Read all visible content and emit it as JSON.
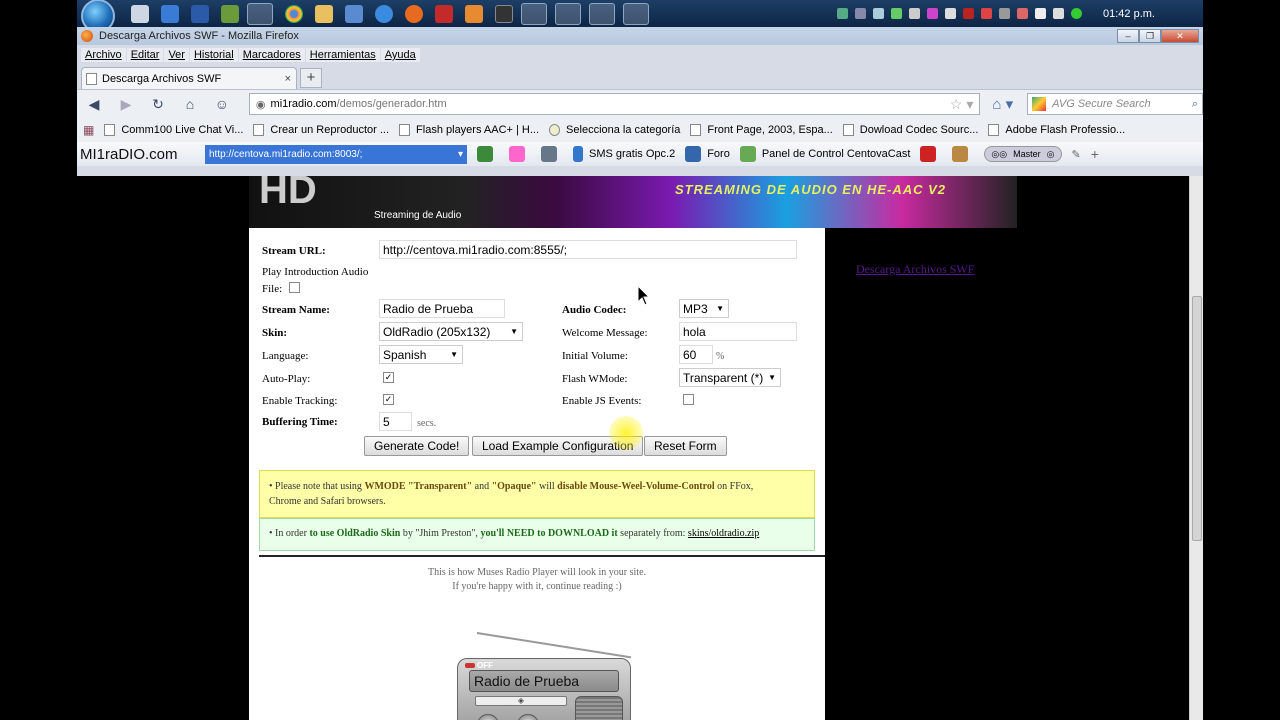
{
  "taskbar": {
    "clock": "01:42 p.m."
  },
  "browser": {
    "window_title": "Descarga Archivos SWF - Mozilla Firefox",
    "menu": [
      "Archivo",
      "Editar",
      "Ver",
      "Historial",
      "Marcadores",
      "Herramientas",
      "Ayuda"
    ],
    "tab_title": "Descarga Archivos SWF",
    "tab_close": "×",
    "new_tab": "+",
    "url_domain": "mi1radio.com",
    "url_path": "/demos/generador.htm",
    "search_placeholder": "AVG Secure Search",
    "bookmarks": [
      "Comm100 Live Chat Vi...",
      "Crear un Reproductor ...",
      "Flash players AAC+ | H...",
      "Selecciona la categoría",
      "Front Page, 2003, Espa...",
      "Dowload Codec Sourc...",
      "Adobe Flash Professio..."
    ],
    "toolbar": {
      "logo": "MI1raDIO.com",
      "url": "http://centova.mi1radio.com:8003/;",
      "sms": "SMS gratis Opc.2",
      "foro": "Foro",
      "panel": "Panel de Control CentovaCast",
      "master": "Master"
    }
  },
  "banner": {
    "hd": "HD",
    "subtitle": "Streaming de Audio",
    "title": "STREAMING DE AUDIO EN HE-AAC V2"
  },
  "form": {
    "stream_url_label": "Stream URL:",
    "stream_url_value": "http://centova.mi1radio.com:8555/;",
    "intro_label_1": "Play Introduction Audio",
    "intro_label_2": "File:",
    "stream_name_label": "Stream Name:",
    "stream_name_value": "Radio de Prueba",
    "audio_codec_label": "Audio Codec:",
    "audio_codec_value": "MP3",
    "skin_label": "Skin:",
    "skin_value": "OldRadio (205x132)",
    "welcome_label": "Welcome Message:",
    "welcome_value": "hola",
    "language_label": "Language:",
    "language_value": "Spanish",
    "volume_label": "Initial Volume:",
    "volume_value": "60",
    "volume_suffix": "%",
    "autoplay_label": "Auto-Play:",
    "wmode_label": "Flash WMode:",
    "wmode_value": "Transparent (*)",
    "tracking_label": "Enable Tracking:",
    "js_events_label": "Enable JS Events:",
    "buffering_label": "Buffering Time:",
    "buffering_value": "5",
    "buffering_suffix": "secs.",
    "generate_button": "Generate Code!",
    "load_example_button": "Load Example Configuration",
    "reset_button": "Reset Form"
  },
  "notes": {
    "yellow_1": "• Please note that using ",
    "yellow_2": "WMODE \"Transparent\"",
    "yellow_3": " and ",
    "yellow_4": "\"Opaque\"",
    "yellow_5": " will ",
    "yellow_6": "disable Mouse-Weel-Volume-Control",
    "yellow_7": " on FFox,",
    "yellow_8": "Chrome and Safari browsers.",
    "green_1": "• In order ",
    "green_2": "to use OldRadio Skin",
    "green_3": " by \"Jhim Preston\", ",
    "green_4": "you'll NEED to DOWNLOAD it",
    "green_5": " separately from: ",
    "green_link": "skins/oldradio.zip"
  },
  "preview": {
    "line1": "This is how Muses Radio Player will look in your site.",
    "line2": "If you're happy with it, continue reading :)",
    "radio_off": "OFF",
    "radio_name": "Radio de Prueba"
  },
  "sidebar": {
    "link": "Descarga Archivos SWF"
  }
}
